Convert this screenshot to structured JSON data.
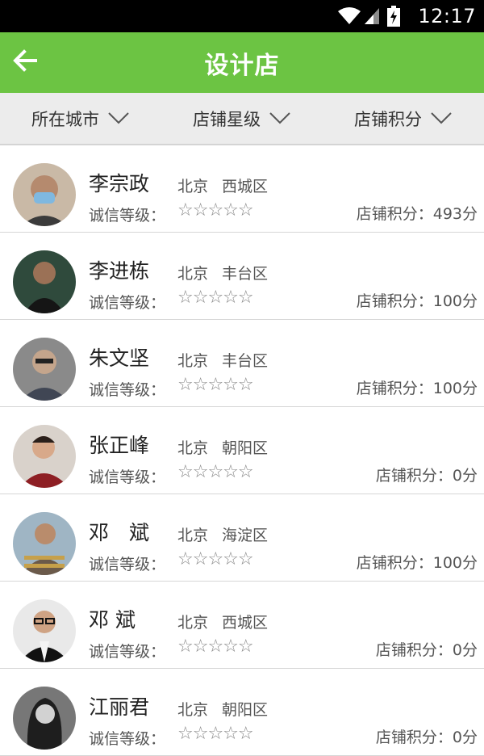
{
  "status_bar": {
    "time": "12:17"
  },
  "header": {
    "title": "设计店",
    "back_icon": "arrow-left-icon"
  },
  "filters": [
    {
      "label": "所在城市",
      "icon": "chevron-down-icon"
    },
    {
      "label": "店铺星级",
      "icon": "chevron-down-icon"
    },
    {
      "label": "店铺积分",
      "icon": "chevron-down-icon"
    }
  ],
  "labels": {
    "rating": "诚信等级：",
    "score_prefix": "店铺积分：",
    "score_suffix": "分",
    "stars": "☆☆☆☆☆"
  },
  "colors": {
    "accent": "#6cc443",
    "status_bar": "#000000",
    "filter_bg": "#ececec"
  },
  "stores": [
    {
      "name": "李宗政",
      "city": "北京",
      "district": "西城区",
      "score": "店铺积分：493分"
    },
    {
      "name": "李进栋",
      "city": "北京",
      "district": "丰台区",
      "score": "店铺积分：100分"
    },
    {
      "name": "朱文坚",
      "city": "北京",
      "district": "丰台区",
      "score": "店铺积分：100分"
    },
    {
      "name": "张正峰",
      "city": "北京",
      "district": "朝阳区",
      "score": "店铺积分：0分"
    },
    {
      "name": "邓　斌",
      "city": "北京",
      "district": "海淀区",
      "score": "店铺积分：100分"
    },
    {
      "name": "邓 斌",
      "city": "北京",
      "district": "西城区",
      "score": "店铺积分：0分"
    },
    {
      "name": "江丽君",
      "city": "北京",
      "district": "朝阳区",
      "score": "店铺积分：0分"
    }
  ]
}
